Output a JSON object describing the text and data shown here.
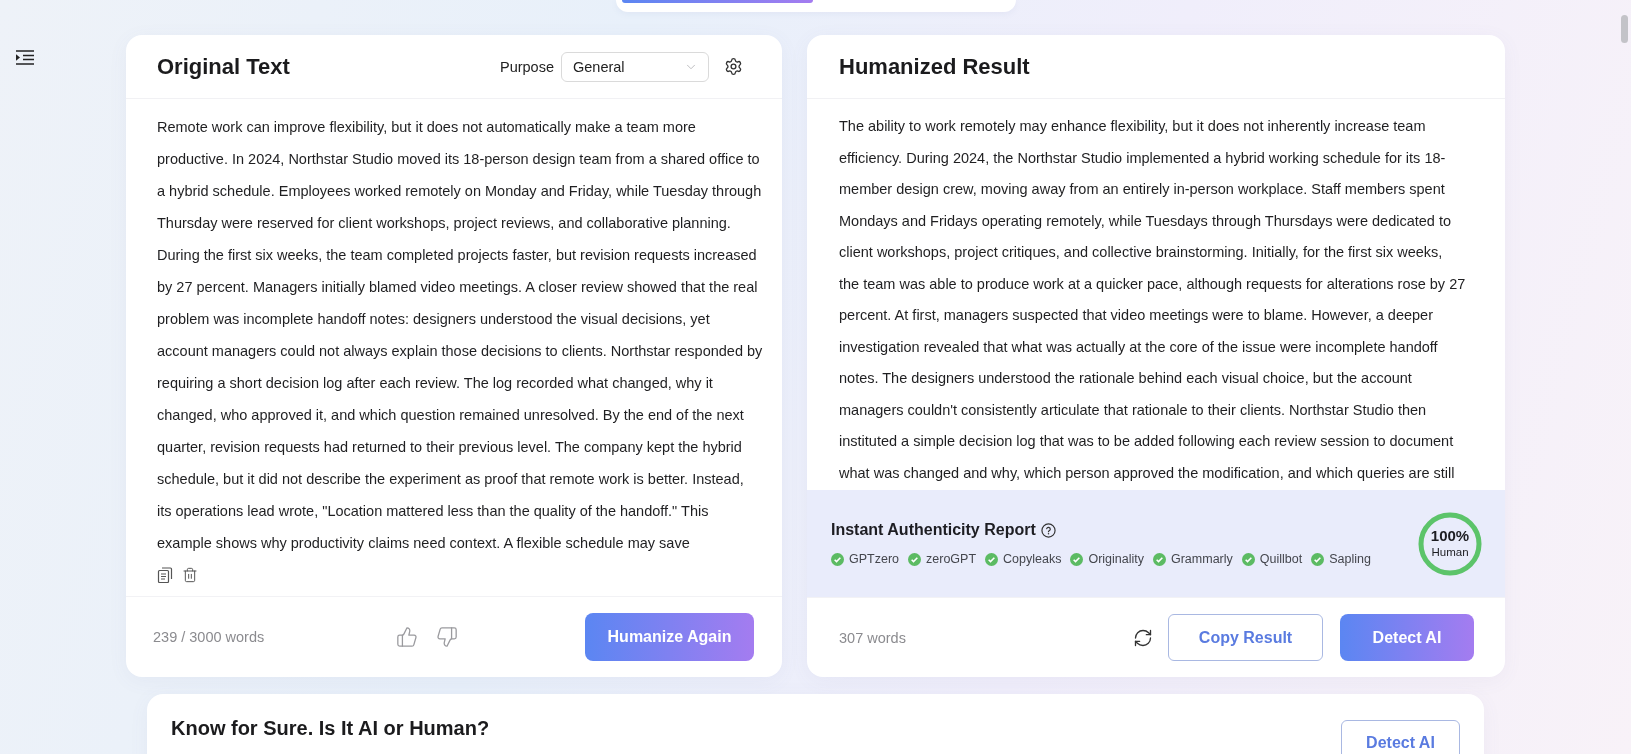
{
  "input_panel": {
    "title": "Original Text",
    "purpose": {
      "label": "Purpose",
      "value": "General"
    },
    "text_lines": [
      "Remote work can improve flexibility, but it does not automatically make a team more",
      "productive. In 2024, Northstar Studio moved its 18-person design team from a shared office to",
      "a hybrid schedule. Employees worked remotely on Monday and Friday, while Tuesday through",
      "Thursday were reserved for client workshops, project reviews, and collaborative planning.",
      "During the first six weeks, the team completed projects faster, but revision requests increased",
      "by 27 percent. Managers initially blamed video meetings. A closer review showed that the real",
      "problem was incomplete handoff notes: designers understood the visual decisions, yet",
      "account managers could not always explain those decisions to clients. Northstar responded by",
      "requiring a short decision log after each review. The log recorded what changed, why it",
      "changed, who approved it, and which question remained unresolved. By the end of the next",
      "quarter, revision requests had returned to their previous level. The company kept the hybrid",
      "schedule, but it did not describe the experiment as proof that remote work is better. Instead,",
      "its operations lead wrote, \"Location mattered less than the quality of the handoff.\" This",
      "example shows why productivity claims need context. A flexible schedule may save"
    ],
    "word_count": "239 / 3000 words",
    "primary_button": "Humanize Again"
  },
  "result_panel": {
    "title": "Humanized Result",
    "text_lines": [
      "The ability to work remotely may enhance flexibility, but it does not inherently increase team",
      "efficiency. During 2024, the Northstar Studio implemented a hybrid working schedule for its 18-",
      "member design crew, moving away from an entirely in-person workplace. Staff members spent",
      "Mondays and Fridays operating remotely, while Tuesdays through Thursdays were dedicated to",
      "client workshops, project critiques, and collective brainstorming. Initially, for the first six weeks,",
      "the team was able to produce work at a quicker pace, although requests for alterations rose by 27",
      "percent. At first, managers suspected that video meetings were to blame. However, a deeper",
      "investigation revealed that what was actually at the core of the issue were incomplete handoff",
      "notes. The designers understood the rationale behind each visual choice, but the account",
      "managers couldn't consistently articulate that rationale to their clients. Northstar Studio then",
      "instituted a simple decision log that was to be added following each review session to document",
      "what was changed and why, which person approved the modification, and which queries are still"
    ],
    "report": {
      "title": "Instant Authenticity Report",
      "detectors": [
        {
          "name": "GPTzero",
          "passed": true
        },
        {
          "name": "zeroGPT",
          "passed": true
        },
        {
          "name": "Copyleaks",
          "passed": true
        },
        {
          "name": "Originality",
          "passed": true
        },
        {
          "name": "Grammarly",
          "passed": true
        },
        {
          "name": "Quillbot",
          "passed": true
        },
        {
          "name": "Sapling",
          "passed": true
        }
      ],
      "score": {
        "value": "100%",
        "label": "Human",
        "level": 1
      }
    },
    "word_count": "307 words",
    "buttons": [
      {
        "label": "Copy Result",
        "kind": "outline"
      },
      {
        "label": "Detect AI",
        "kind": "filled"
      }
    ]
  },
  "detector_promo": {
    "title": "Know for Sure. Is It AI or Human?",
    "button": "Detect AI"
  }
}
